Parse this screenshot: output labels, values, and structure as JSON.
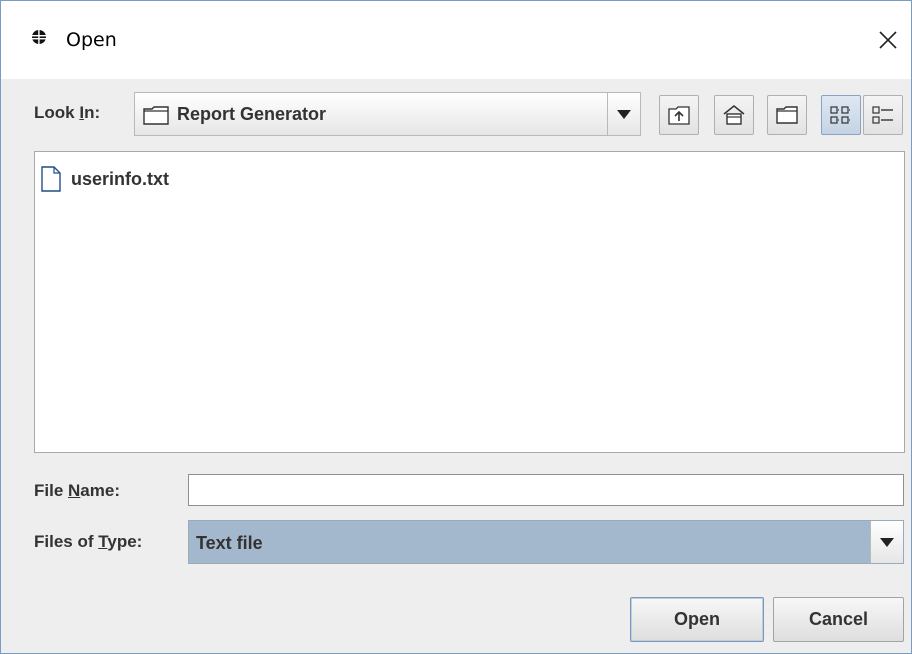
{
  "window": {
    "title": "Open",
    "icons": {
      "app": "java-duke-icon",
      "close": "close-icon"
    }
  },
  "look_in": {
    "label_pre": "Look ",
    "label_mnemonic": "I",
    "label_post": "n:",
    "value": "Report Generator",
    "icon": "folder-icon"
  },
  "toolbar": [
    {
      "name": "up-one-level-button",
      "icon": "folder-up-icon"
    },
    {
      "name": "home-button",
      "icon": "home-icon"
    },
    {
      "name": "new-folder-button",
      "icon": "new-folder-icon"
    },
    {
      "name": "list-view-button",
      "icon": "list-view-icon",
      "selected": true
    },
    {
      "name": "details-view-button",
      "icon": "details-view-icon",
      "selected": false
    }
  ],
  "files": [
    {
      "name": "userinfo.txt",
      "icon": "file-icon"
    }
  ],
  "file_name": {
    "label_pre": "File ",
    "label_mnemonic": "N",
    "label_post": "ame:",
    "value": ""
  },
  "file_type": {
    "label_pre": "Files of ",
    "label_mnemonic": "T",
    "label_post": "ype:",
    "value": "Text file"
  },
  "buttons": {
    "open": "Open",
    "cancel": "Cancel"
  },
  "colors": {
    "dialog_bg": "#eeeeee",
    "selected_combo_bg": "#a3b8cc",
    "accent_border": "#7a9bc4"
  }
}
